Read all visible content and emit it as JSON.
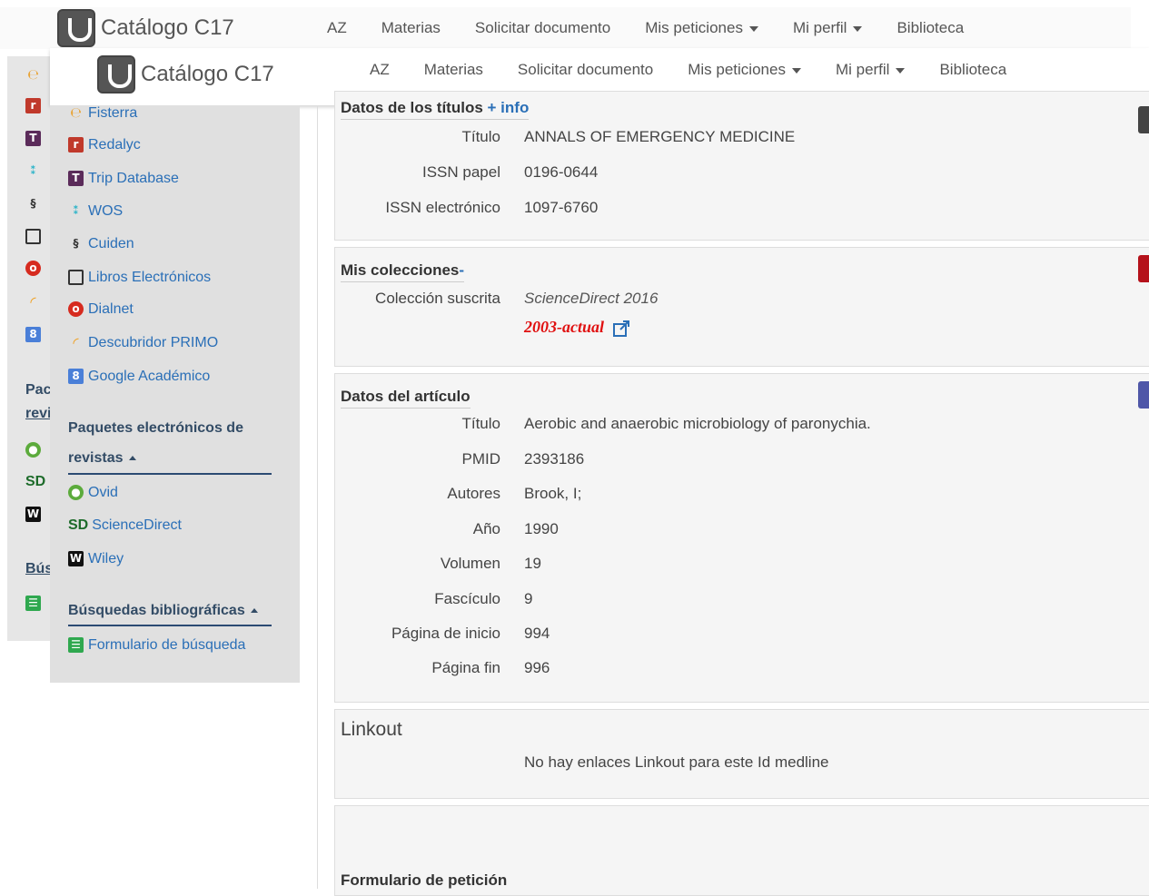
{
  "brand": "Catálogo C17",
  "nav": {
    "az": "AZ",
    "materias": "Materias",
    "solicitar": "Solicitar documento",
    "peticiones": "Mis peticiones",
    "perfil": "Mi perfil",
    "biblioteca": "Biblioteca"
  },
  "back_sidebar": {
    "paquetes_short1": "Pac",
    "paquetes_short2": "revi",
    "busquedas_short": "Bús"
  },
  "sidebar": {
    "resources": [
      {
        "label": "Fisterra",
        "icon": "fisterra-icon"
      },
      {
        "label": "Redalyc",
        "icon": "redalyc-icon"
      },
      {
        "label": "Trip Database",
        "icon": "trip-database-icon"
      },
      {
        "label": "WOS",
        "icon": "wos-icon"
      },
      {
        "label": "Cuiden",
        "icon": "cuiden-icon"
      },
      {
        "label": "Libros Electrónicos",
        "icon": "book-icon"
      },
      {
        "label": "Dialnet",
        "icon": "dialnet-icon"
      },
      {
        "label": "Descubridor PRIMO",
        "icon": "primo-icon"
      },
      {
        "label": "Google Académico",
        "icon": "google-scholar-icon"
      }
    ],
    "paquetes_heading_1": "Paquetes electrónicos de",
    "paquetes_heading_2": "revistas",
    "paquetes": [
      {
        "label": "Ovid",
        "icon": "ovid-icon"
      },
      {
        "label": "ScienceDirect",
        "icon": "sciencedirect-icon"
      },
      {
        "label": "Wiley",
        "icon": "wiley-icon"
      }
    ],
    "busquedas_heading": "Búsquedas bibliográficas",
    "busquedas": [
      {
        "label": "Formulario de búsqueda",
        "icon": "form-icon"
      }
    ]
  },
  "titulos": {
    "title": "Datos de los títulos",
    "more": "+ info",
    "rows": [
      {
        "label": "Título",
        "value": "ANNALS OF EMERGENCY MEDICINE"
      },
      {
        "label": "ISSN papel",
        "value": "0196-0644"
      },
      {
        "label": "ISSN electrónico",
        "value": "1097-6760"
      }
    ]
  },
  "colecciones": {
    "title": "Mis colecciones",
    "toggle": "-",
    "label": "Colección suscrita",
    "collection": "ScienceDirect 2016",
    "range": "2003-actual"
  },
  "articulo": {
    "title": "Datos del artículo",
    "rows": [
      {
        "label": "Título",
        "value": "Aerobic and anaerobic microbiology of paronychia."
      },
      {
        "label": "PMID",
        "value": "2393186"
      },
      {
        "label": "Autores",
        "value": "Brook, I;"
      },
      {
        "label": "Año",
        "value": "1990"
      },
      {
        "label": "Volumen",
        "value": "19"
      },
      {
        "label": "Fascículo",
        "value": "9"
      },
      {
        "label": "Página de inicio",
        "value": "994"
      },
      {
        "label": "Página fin",
        "value": "996"
      }
    ]
  },
  "linkout": {
    "title": "Linkout",
    "message": "No hay enlaces Linkout para este Id medline"
  },
  "peticion": {
    "title": "Formulario de petición"
  },
  "colors": {
    "link": "#2a6fb7",
    "range_red": "#e01010",
    "heading_blue": "#334c66"
  }
}
